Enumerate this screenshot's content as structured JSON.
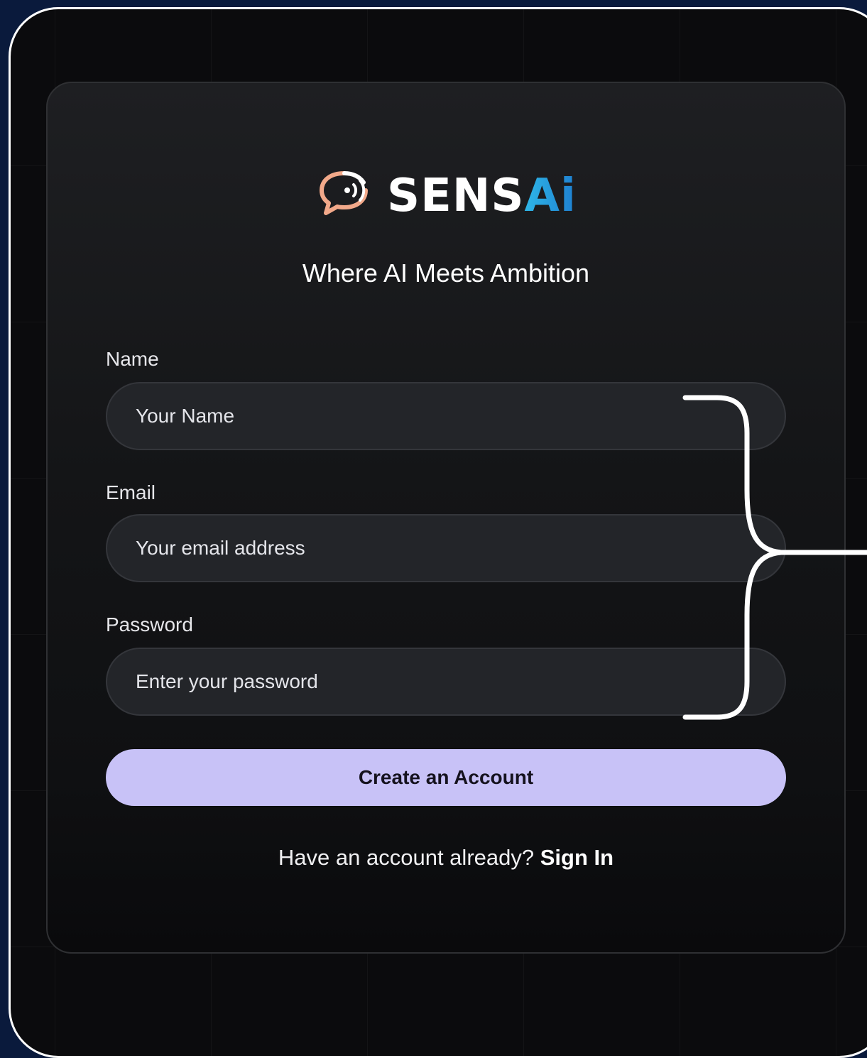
{
  "brand": {
    "name_main": "SENS",
    "name_accent": "Ai",
    "tagline": "Where AI Meets Ambition",
    "logo_icon": "chat-bubble-signal-icon",
    "colors": {
      "background": "#0a1a3c",
      "card": "#1a1b1e",
      "input": "#232529",
      "primary_button": "#c8c2f7",
      "logo_accent": "#2fb7e8",
      "logo_icon": "#f2a98a"
    }
  },
  "form": {
    "name": {
      "label": "Name",
      "placeholder": "Your Name",
      "value": ""
    },
    "email": {
      "label": "Email",
      "placeholder": "Your email address",
      "value": ""
    },
    "password": {
      "label": "Password",
      "placeholder": "Enter your password",
      "value": ""
    },
    "submit_label": "Create an Account"
  },
  "footer": {
    "prompt": "Have an account already?",
    "link_label": "Sign In"
  },
  "annotation": {
    "type": "curly-brace",
    "color": "#ffffff"
  }
}
